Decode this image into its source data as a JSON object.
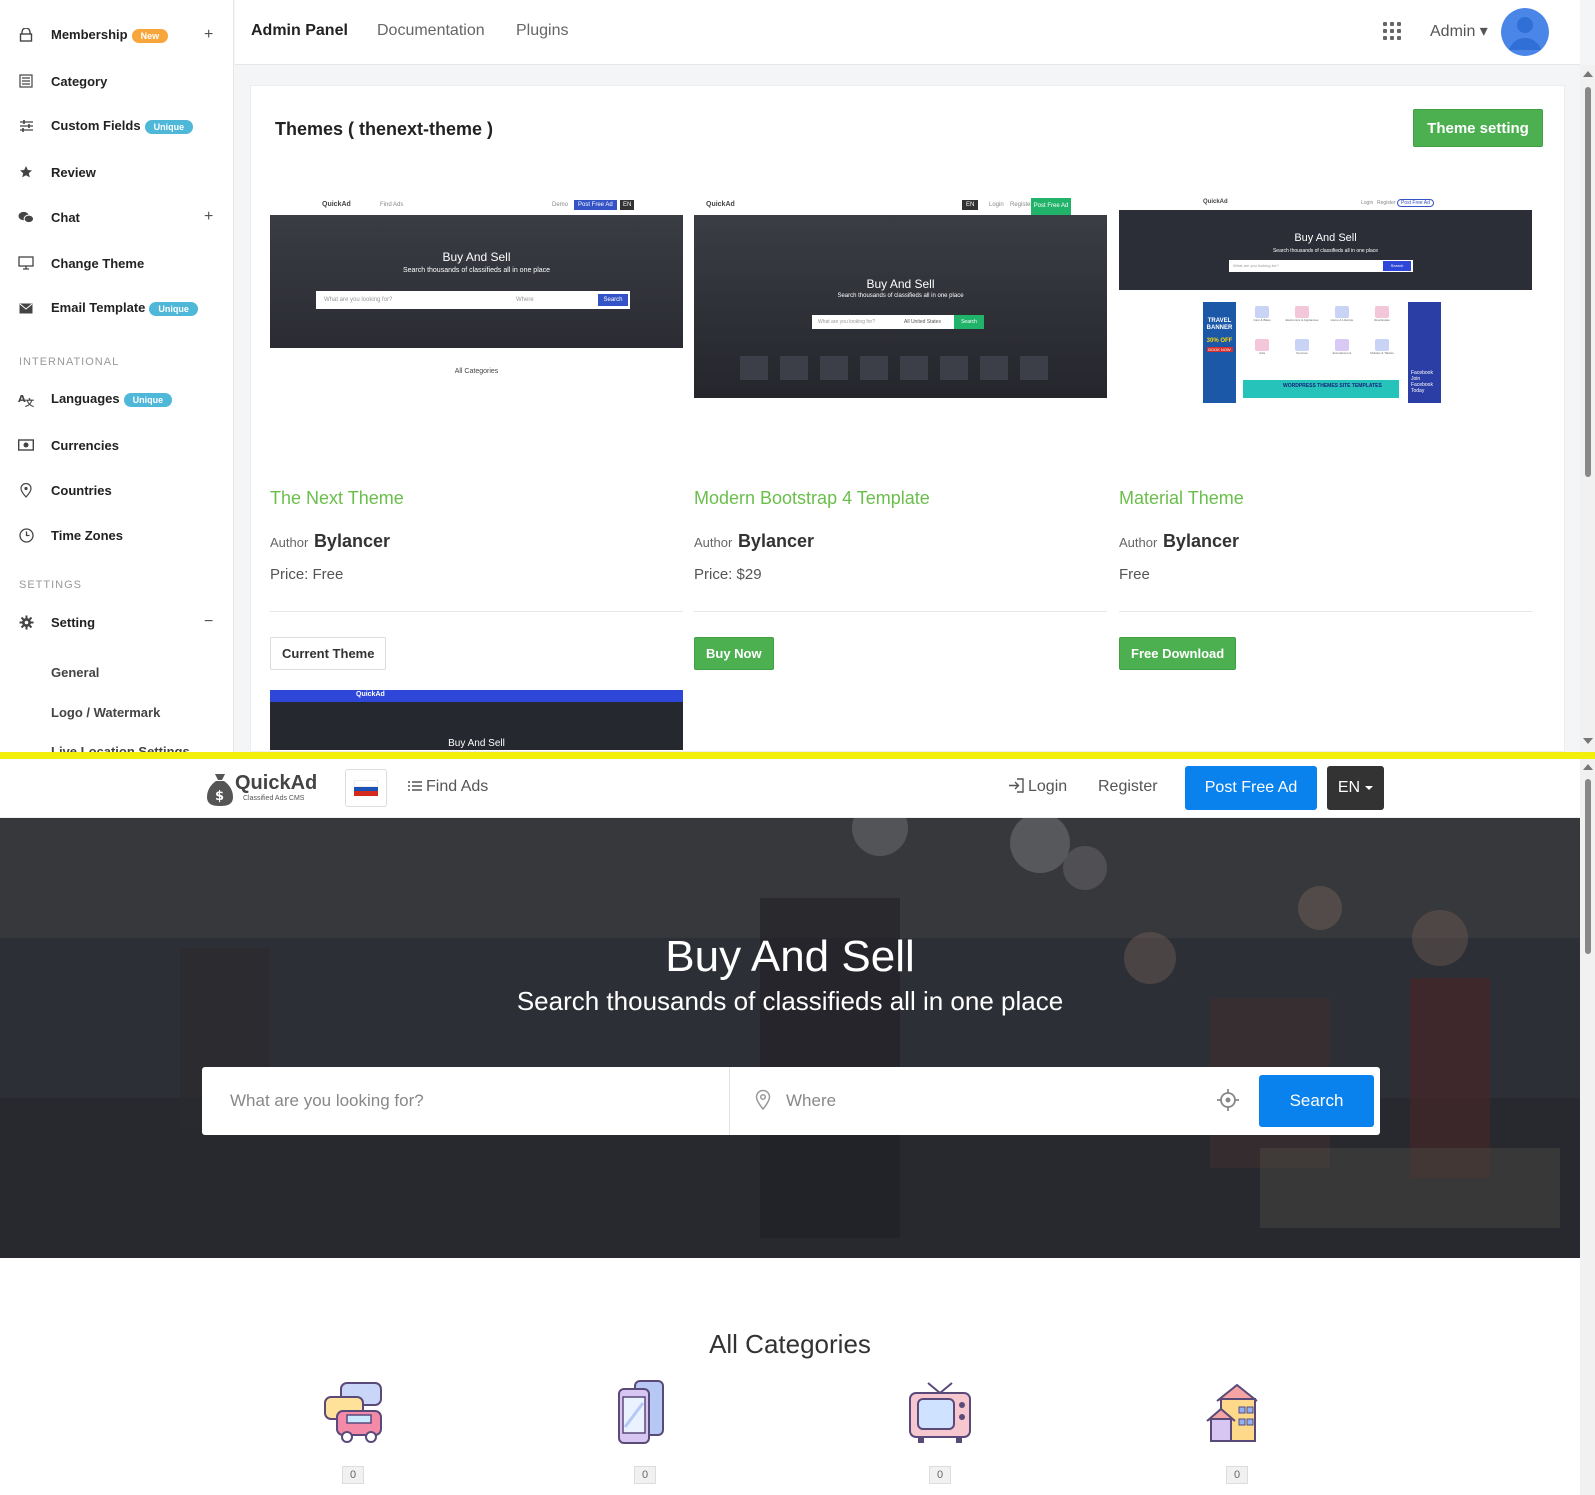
{
  "admin": {
    "sidebar": {
      "items": [
        {
          "label": "Membership",
          "badge": "New",
          "expand": "+"
        },
        {
          "label": "Category"
        },
        {
          "label": "Custom Fields",
          "badge": "Unique"
        },
        {
          "label": "Review"
        },
        {
          "label": "Chat",
          "expand": "+"
        },
        {
          "label": "Change Theme"
        },
        {
          "label": "Email Template",
          "badge": "Unique"
        },
        {
          "label": "Languages",
          "badge": "Unique"
        },
        {
          "label": "Currencies"
        },
        {
          "label": "Countries"
        },
        {
          "label": "Time Zones"
        },
        {
          "label": "Setting",
          "expand": "−"
        }
      ],
      "sections": {
        "international": "INTERNATIONAL",
        "settings": "SETTINGS"
      },
      "sub_items": [
        "General",
        "Logo / Watermark",
        "Live Location Settings"
      ]
    },
    "topbar": {
      "links": [
        "Admin Panel",
        "Documentation",
        "Plugins"
      ],
      "user": "Admin ▾"
    },
    "card": {
      "title": "Themes ( thenext-theme )",
      "theme_setting_button": "Theme setting",
      "themes": [
        {
          "name": "The Next Theme",
          "author_label": "Author",
          "author": "Bylancer",
          "price": "Price: Free",
          "button": "Current Theme"
        },
        {
          "name": "Modern Bootstrap 4 Template",
          "author_label": "Author",
          "author": "Bylancer",
          "price": "Price: $29",
          "button": "Buy Now"
        },
        {
          "name": "Material Theme",
          "author_label": "Author",
          "author": "Bylancer",
          "price": "Free",
          "button": "Free Download"
        }
      ],
      "preview": {
        "brand": "QuickAd",
        "hero_title": "Buy And Sell",
        "hero_sub": "Search thousands of classifieds all in one place",
        "what": "What are you looking for?",
        "where": "Where",
        "search": "Search",
        "all_categories": "All Categories",
        "find_ads": "Find Ads",
        "post": "Post Free Ad",
        "lang": "EN",
        "demo": "Demo",
        "login": "Login",
        "register": "Register",
        "country": "All United States",
        "travel": "TRAVEL BANNER",
        "off": "30% OFF",
        "book": "BOOK NOW",
        "wp": "WORDPRESS THEMES SITE TEMPLATES",
        "fb": "Facebook Join Facebook Today",
        "cats": [
          "Cars & Bikes",
          "Electronics & Appliances",
          "Home & Lifestyle",
          "Real Estate",
          "Jobs",
          "Services",
          "Entertainment",
          "Mobiles & Tablets"
        ]
      }
    }
  },
  "site": {
    "logo": {
      "name": "QuickAd",
      "tagline": "Classified Ads CMS"
    },
    "nav": {
      "find_ads": "Find Ads",
      "login": "Login",
      "register": "Register",
      "post_ad": "Post Free Ad",
      "lang": "EN"
    },
    "hero": {
      "title": "Buy And Sell",
      "subtitle": "Search thousands of classifieds all in one place",
      "search_placeholder": "What are you looking for?",
      "where_placeholder": "Where",
      "search_button": "Search"
    },
    "categories": {
      "title": "All Categories",
      "items": [
        {
          "icon": "cars-icon",
          "count": "0"
        },
        {
          "icon": "mobiles-icon",
          "count": "0"
        },
        {
          "icon": "electronics-icon",
          "count": "0"
        },
        {
          "icon": "real-estate-icon",
          "count": "0"
        }
      ]
    },
    "colors": {
      "primary": "#0a82ee",
      "dark": "#333333"
    }
  },
  "colors": {
    "green": "#4cb050",
    "theme_name": "#6abf4b",
    "badge_new": "#f7a63b",
    "badge_unique": "#4fb7d8"
  }
}
